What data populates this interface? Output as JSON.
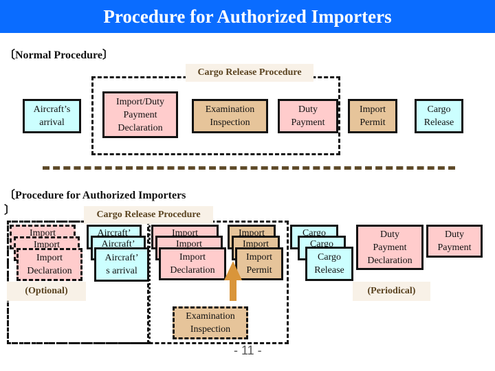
{
  "title": "Procedure for Authorized Importers",
  "normal": {
    "heading": "〔Normal Procedure〕",
    "group_label": "Cargo Release Procedure",
    "steps": [
      {
        "label": "Aircraft’s\narrival",
        "color": "#ccffff"
      },
      {
        "label": "Import/Duty\nPayment\nDeclaration",
        "color": "#ffcccc"
      },
      {
        "label": "Examination\nInspection",
        "color": "#e6c49a"
      },
      {
        "label": "Duty\nPayment",
        "color": "#ffcccc"
      },
      {
        "label": "Import\nPermit",
        "color": "#e6c49a"
      },
      {
        "label": "Cargo\nRelease",
        "color": "#ccffff"
      }
    ]
  },
  "authorized": {
    "heading_line1": "〔Procedure for Authorized Importers",
    "heading_line2": "〕",
    "group_label": "Cargo Release Procedure",
    "stacks": [
      {
        "back": "Import",
        "front": "Import\nDeclaration",
        "color": "#ffcccc",
        "style": "dashed"
      },
      {
        "back": "Aircraft’",
        "front": "Aircraft’\ns arrival",
        "color": "#ccffff",
        "style": "solid"
      },
      {
        "back": "Import",
        "front": "Import\nDeclaration",
        "color": "#ffcccc",
        "style": "solid"
      },
      {
        "back": "Import",
        "front": "Import\nPermit",
        "color": "#e6c49a",
        "style": "solid"
      },
      {
        "back": "Cargo",
        "front": "Cargo\nRelease",
        "color": "#ccffff",
        "style": "solid"
      }
    ],
    "duty_payment_declaration": "Duty\nPayment\nDeclaration",
    "duty_payment": "Duty\nPayment",
    "optional_label": "(Optional)",
    "periodical_label": "(Periodical)",
    "examination": "Examination\nInspection"
  },
  "page_number": "- 11 -",
  "colors": {
    "title_bar": "#0a6cff",
    "cyan": "#ccffff",
    "pink": "#ffcccc",
    "tan": "#e6c49a",
    "arrow": "#d9953a",
    "label_text": "#5a4320"
  }
}
